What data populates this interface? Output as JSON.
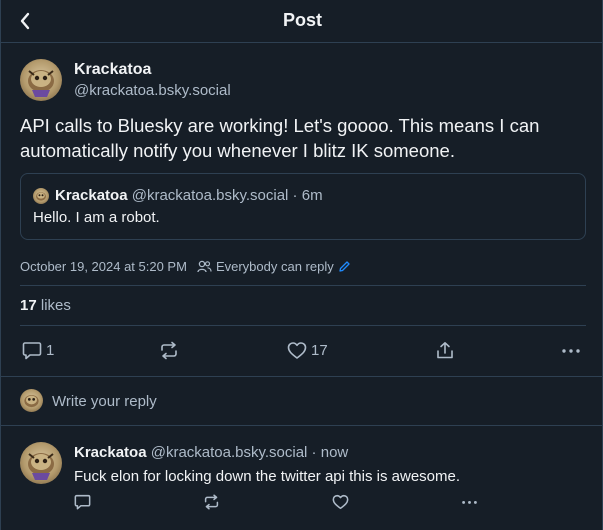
{
  "header": {
    "title": "Post"
  },
  "post": {
    "author": {
      "name": "Krackatoa",
      "handle": "@krackatoa.bsky.social"
    },
    "text": "API calls to Bluesky are working! Let's goooo. This means I can automatically notify you whenever I blitz IK someone.",
    "quote": {
      "name": "Krackatoa",
      "handle_time": "@krackatoa.bsky.social · 6m",
      "text": "Hello. I am a robot."
    },
    "timestamp": "October 19, 2024 at 5:20 PM",
    "reply_setting": "Everybody can reply",
    "likes": {
      "count": "17",
      "label": "likes"
    },
    "actions": {
      "reply_count": "1",
      "like_count": "17"
    }
  },
  "reply_box": {
    "placeholder": "Write your reply"
  },
  "thread_reply": {
    "name": "Krackatoa",
    "handle_time": "@krackatoa.bsky.social · now",
    "text": "Fuck elon for locking down the twitter api this is awesome."
  },
  "icons": {
    "back": "chevron-left-icon",
    "people": "people-icon",
    "edit": "pencil-icon",
    "reply": "speech-bubble-icon",
    "repost": "repost-icon",
    "like": "heart-icon",
    "share": "share-icon",
    "more": "more-dots-icon"
  },
  "colors": {
    "background": "#161e27",
    "border": "#2e4052",
    "text_primary": "#f1f3f5",
    "text_secondary": "#aebbc9",
    "accent": "#208bfe"
  }
}
